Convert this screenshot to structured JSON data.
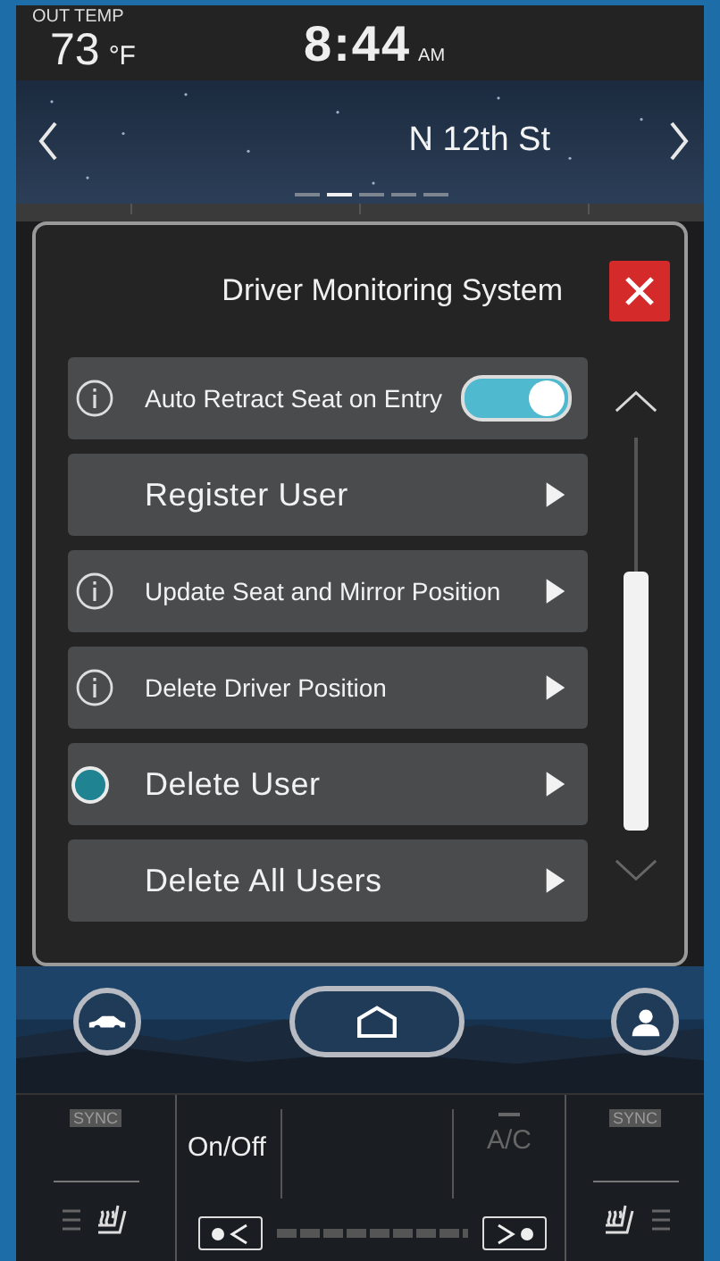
{
  "status_bar": {
    "out_temp_label": "OUT TEMP",
    "temperature": "73",
    "temp_unit": "°F",
    "time": "8:44",
    "meridiem": "AM"
  },
  "nav": {
    "street": "N 12th St",
    "pages": [
      {
        "selected": false
      },
      {
        "selected": true
      },
      {
        "selected": false
      },
      {
        "selected": false
      },
      {
        "selected": false
      }
    ]
  },
  "dialog": {
    "title": "Driver Monitoring System",
    "items": [
      {
        "kind": "toggle",
        "label": "Auto Retract Seat on Entry",
        "info": true,
        "on": true,
        "selected": false
      },
      {
        "kind": "arrow",
        "label": "Register User",
        "info": false,
        "selected": false
      },
      {
        "kind": "arrow",
        "label": "Update Seat and Mirror Position",
        "info": true,
        "selected": false
      },
      {
        "kind": "arrow",
        "label": "Delete Driver Position",
        "info": true,
        "selected": false
      },
      {
        "kind": "arrow",
        "label": "Delete User",
        "info": false,
        "selected": true
      },
      {
        "kind": "arrow",
        "label": "Delete All Users",
        "info": false,
        "selected": false
      }
    ]
  },
  "climate": {
    "left_sync": "SYNC",
    "power": "On/Off",
    "ac": {
      "label": "A/C",
      "on": false
    },
    "right_sync": "SYNC"
  }
}
